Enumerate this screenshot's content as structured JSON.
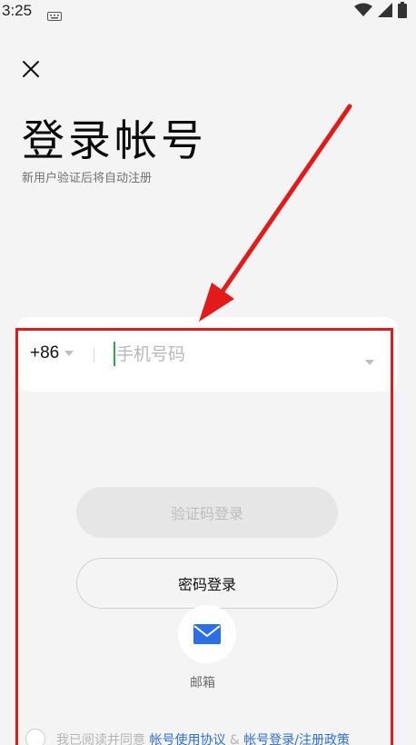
{
  "status_bar": {
    "time": "3:25"
  },
  "header": {
    "title": "登录帐号",
    "subtitle": "新用户验证后将自动注册"
  },
  "phone": {
    "country_code": "+86",
    "placeholder": "手机号码",
    "value": ""
  },
  "buttons": {
    "code_login": "验证码登录",
    "password_login": "密码登录"
  },
  "alt_login": {
    "email_label": "邮箱"
  },
  "agreement": {
    "prefix": "我已阅读并同意 ",
    "link1": "帐号使用协议",
    "separator": " & ",
    "link2": "帐号登录/注册政策"
  },
  "colors": {
    "annotation": "#e21a1a",
    "link": "#2f6fd6",
    "mail_icon": "#2c6ee8",
    "cursor": "#2aa84a"
  }
}
